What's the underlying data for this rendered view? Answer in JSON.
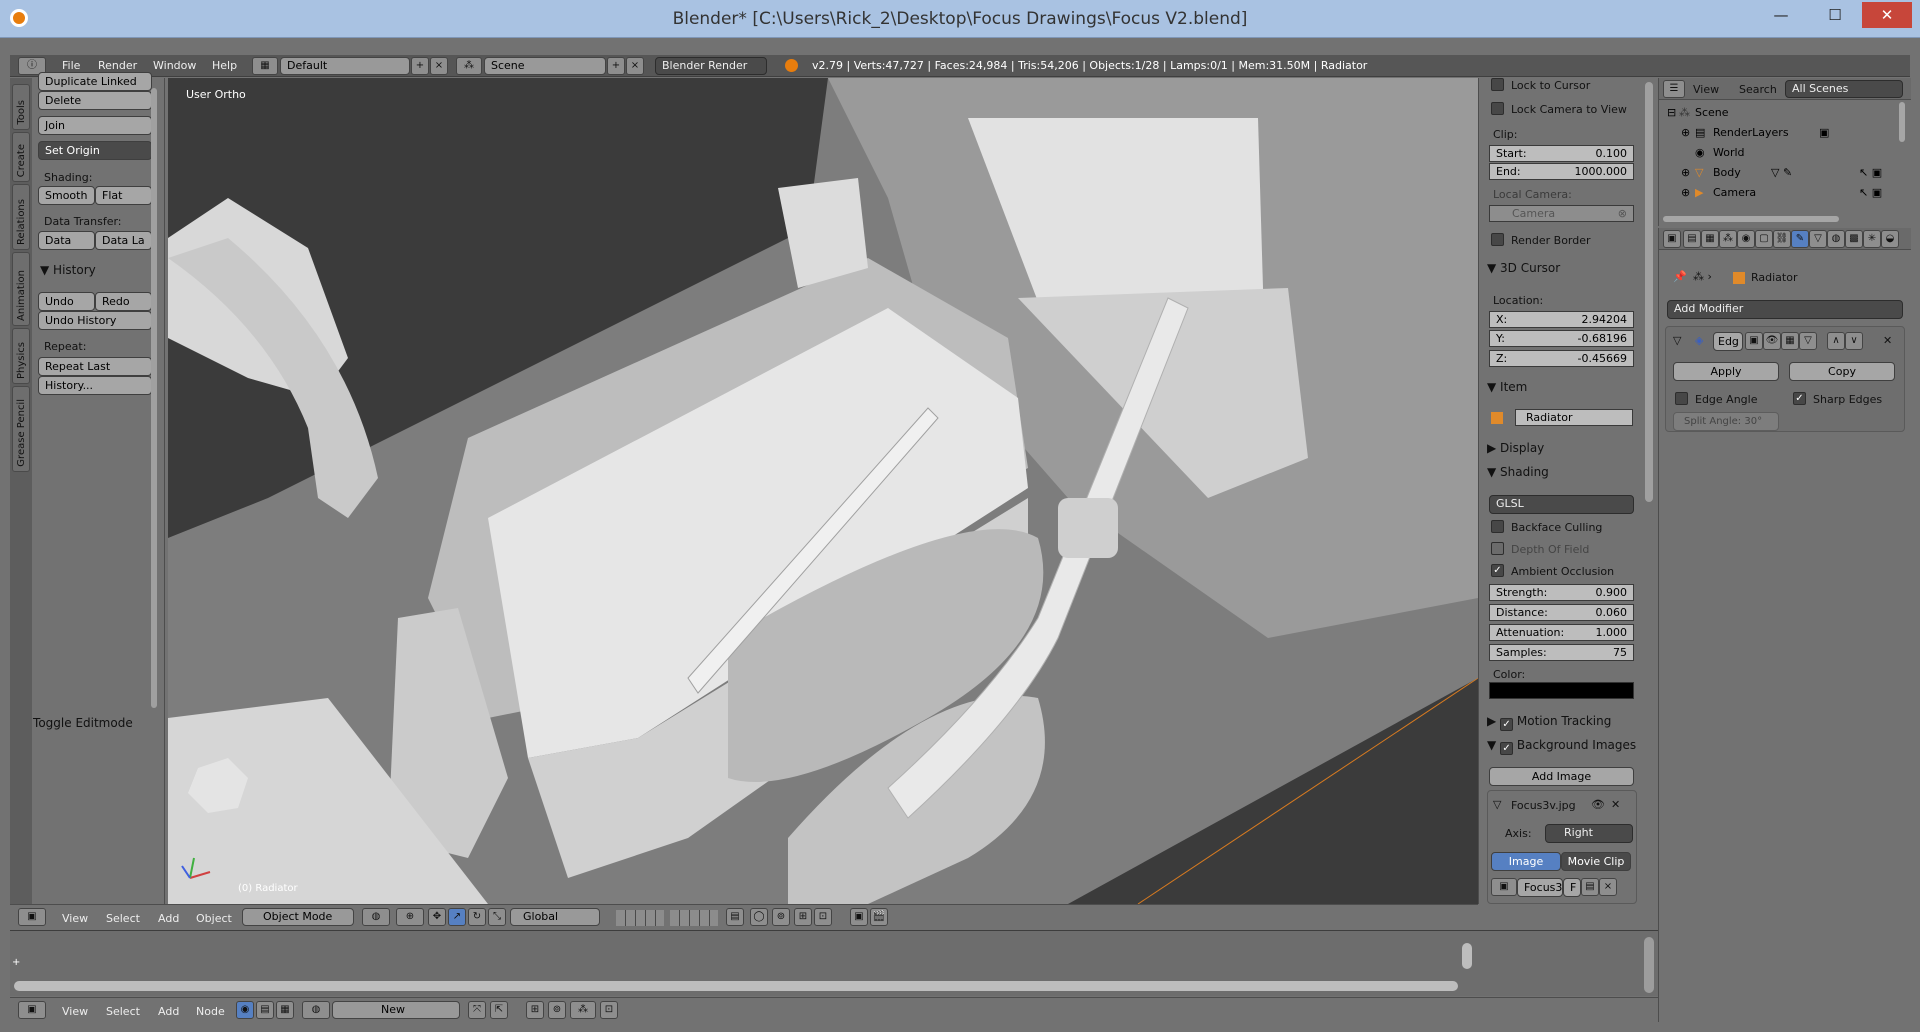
{
  "window": {
    "title": "Blender* [C:\\Users\\Rick_2\\Desktop\\Focus Drawings\\Focus V2.blend]",
    "min": "—",
    "max": "☐",
    "close": "✕"
  },
  "menubar": {
    "items": [
      "File",
      "Render",
      "Window",
      "Help"
    ],
    "layout": "Default",
    "scene": "Scene",
    "engine": "Blender Render",
    "stats": "v2.79 | Verts:47,727 | Faces:24,984 | Tris:54,206 | Objects:1/28 | Lamps:0/1 | Mem:31.50M | Radiator"
  },
  "tool_tabs": [
    "Tools",
    "Create",
    "Relations",
    "Animation",
    "Physics",
    "Grease Pencil"
  ],
  "tools": {
    "dup_linked": "Duplicate Linked",
    "delete": "Delete",
    "join": "Join",
    "set_origin": "Set Origin",
    "shading_label": "Shading:",
    "smooth": "Smooth",
    "flat": "Flat",
    "data_transfer_label": "Data Transfer:",
    "data": "Data",
    "data_la": "Data La",
    "history_header": "History",
    "undo": "Undo",
    "redo": "Redo",
    "undo_history": "Undo History",
    "repeat_label": "Repeat:",
    "repeat_last": "Repeat Last",
    "history": "History...",
    "toggle_editmode": "Toggle Editmode"
  },
  "viewport": {
    "label": "User Ortho",
    "object_label": "(0) Radiator"
  },
  "view3d_header": {
    "menus": [
      "View",
      "Select",
      "Add",
      "Object"
    ],
    "mode": "Object Mode",
    "orientation": "Global"
  },
  "node_header": {
    "menus": [
      "View",
      "Select",
      "Add",
      "Node"
    ],
    "new": "New"
  },
  "properties": {
    "lock_cursor": "Lock to Cursor",
    "lock_camera": "Lock Camera to View",
    "clip_label": "Clip:",
    "start_label": "Start:",
    "start": "0.100",
    "end_label": "End:",
    "end": "1000.000",
    "local_camera_label": "Local Camera:",
    "camera": "Camera",
    "render_border": "Render Border",
    "cursor_header": "3D Cursor",
    "location_label": "Location:",
    "x_label": "X:",
    "x": "2.94204",
    "y_label": "Y:",
    "y": "-0.68196",
    "z_label": "Z:",
    "z": "-0.45669",
    "item_header": "Item",
    "item_name": "Radiator",
    "display_header": "Display",
    "shading_header": "Shading",
    "shading_mode": "GLSL",
    "backface": "Backface Culling",
    "dof": "Depth Of Field",
    "ao": "Ambient Occlusion",
    "strength_label": "Strength:",
    "strength": "0.900",
    "distance_label": "Distance:",
    "distance": "0.060",
    "attenuation_label": "Attenuation:",
    "attenuation": "1.000",
    "samples_label": "Samples:",
    "samples": "75",
    "color_label": "Color:",
    "motion_tracking": "Motion Tracking",
    "background_images": "Background Images",
    "add_image": "Add Image",
    "bg_file": "Focus3v.jpg",
    "axis_label": "Axis:",
    "axis": "Right",
    "image_tab": "Image",
    "movie_clip_tab": "Movie Clip",
    "focus_field": "Focus3",
    "f_label": "F"
  },
  "outliner": {
    "view": "View",
    "search": "Search",
    "scenes": "All Scenes",
    "rows": [
      "Scene",
      "RenderLayers",
      "World",
      "Body",
      "Camera"
    ]
  },
  "modifier_panel": {
    "object": "Radiator",
    "add_modifier": "Add Modifier",
    "mod_name": "Edg",
    "apply": "Apply",
    "copy": "Copy",
    "edge_angle": "Edge Angle",
    "sharp_edges": "Sharp Edges",
    "split_angle": "Split Angle: 30°"
  }
}
